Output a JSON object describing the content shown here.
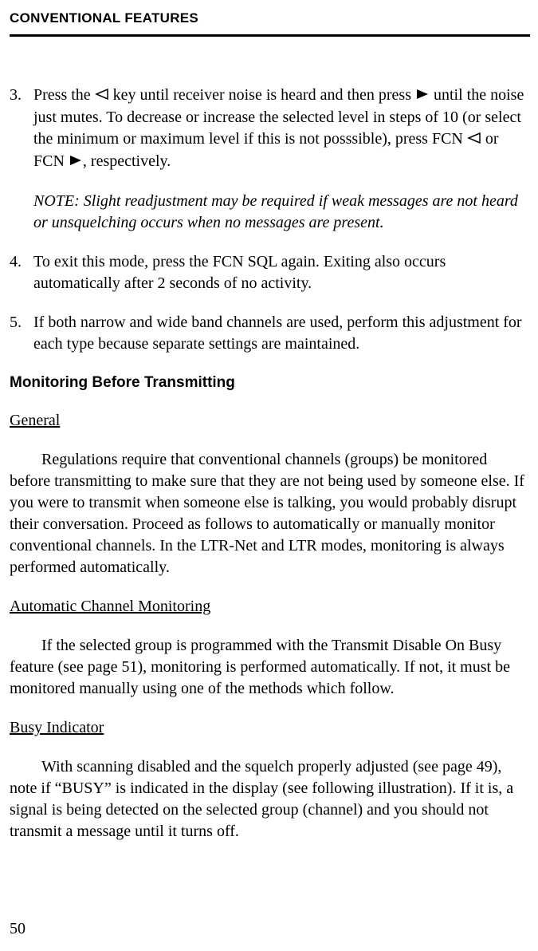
{
  "header": "CONVENTIONAL FEATURES",
  "item3": {
    "num": "3.",
    "part1": "Press the ",
    "part2": " key until receiver noise is heard and then press ",
    "part3": " until the noise just mutes. To decrease or increase the selected level in steps of 10 (or select the minimum or maximum level if this is not posssible), press FCN ",
    "part4": " or FCN ",
    "part5": ", respectively.",
    "note": "NOTE: Slight readjustment may be required if weak messages are not heard or unsquelching occurs when no messages are present."
  },
  "item4": {
    "num": "4.",
    "text": "To exit this mode, press the FCN SQL again. Exiting also occurs automatically after 2 seconds of no activity."
  },
  "item5": {
    "num": "5.",
    "text": "If both narrow and wide band channels are used, perform this adjustment for each type because separate settings are maintained."
  },
  "sectionTitle": "Monitoring Before Transmitting",
  "sub1": "General",
  "para1": "Regulations require that conventional channels (groups) be monitored before transmitting to make sure that they are not being used by someone else. If you were to transmit when someone else is talking, you would probably disrupt their conversation. Proceed as follows to automatically or manually monitor conventional channels. In the LTR-Net and LTR modes, monitoring is always performed automatically.",
  "sub2": "Automatic Channel Monitoring",
  "para2": "If the selected group is programmed with the Transmit Disable On Busy feature (see page 51), monitoring is performed automatically. If not, it must be monitored manually using one of the methods which follow.",
  "sub3": "Busy Indicator",
  "para3": "With scanning disabled and the squelch properly adjusted (see page 49), note if “BUSY” is indicated in the display (see following illustration). If it is, a signal is being detected on the selected group (channel) and you should not transmit a message until it turns off.",
  "pageNum": "50"
}
